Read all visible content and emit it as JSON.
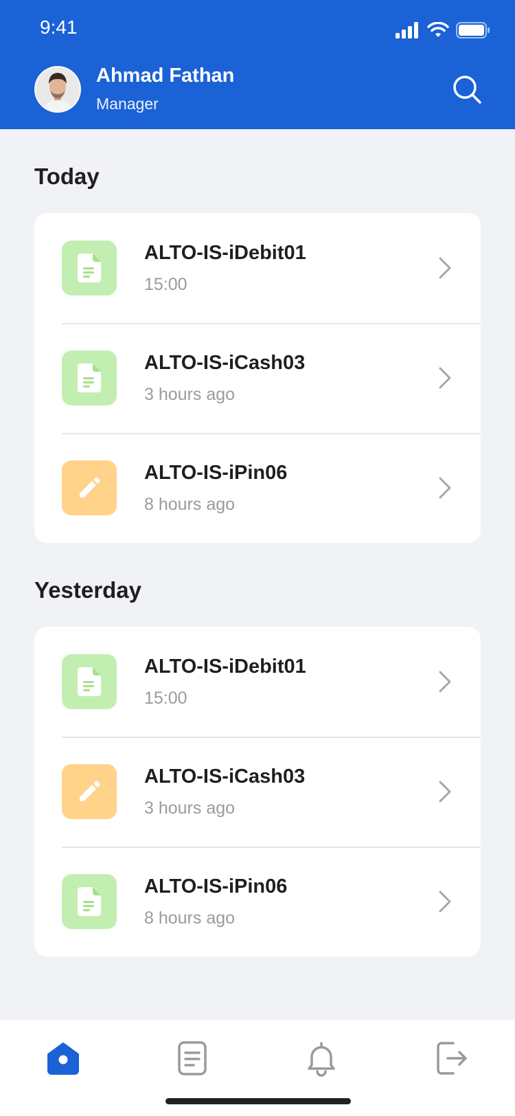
{
  "status_bar": {
    "time": "9:41"
  },
  "user": {
    "name": "Ahmad Fathan",
    "role": "Manager"
  },
  "sections": [
    {
      "title": "Today",
      "items": [
        {
          "title": "ALTO-IS-iDebit01",
          "subtitle": "15:00",
          "icon": "document-icon"
        },
        {
          "title": "ALTO-IS-iCash03",
          "subtitle": "3 hours ago",
          "icon": "document-icon"
        },
        {
          "title": "ALTO-IS-iPin06",
          "subtitle": "8 hours ago",
          "icon": "pencil-icon"
        }
      ]
    },
    {
      "title": "Yesterday",
      "items": [
        {
          "title": "ALTO-IS-iDebit01",
          "subtitle": "15:00",
          "icon": "document-icon"
        },
        {
          "title": "ALTO-IS-iCash03",
          "subtitle": "3 hours ago",
          "icon": "pencil-icon"
        },
        {
          "title": "ALTO-IS-iPin06",
          "subtitle": "8 hours ago",
          "icon": "document-icon"
        }
      ]
    }
  ],
  "tabs": [
    {
      "icon": "home-icon",
      "active": true
    },
    {
      "icon": "list-icon",
      "active": false
    },
    {
      "icon": "bell-icon",
      "active": false
    },
    {
      "icon": "logout-icon",
      "active": false
    }
  ],
  "colors": {
    "primary": "#1A62D6",
    "doc_bg": "#C3EEB2",
    "edit_bg": "#FFD38A",
    "inactive_icon": "#9A9A9A"
  }
}
